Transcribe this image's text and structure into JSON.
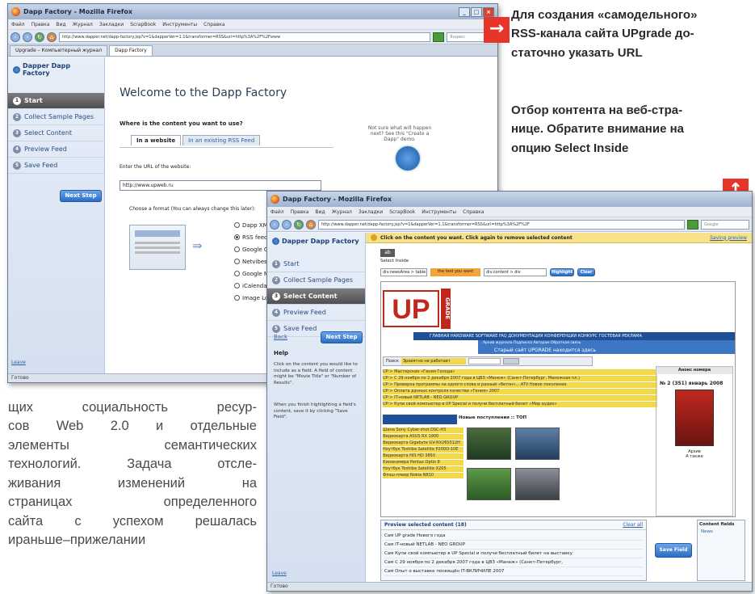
{
  "captions": {
    "top": "Для создания «самодельного»\nRSS-канала сайта UPgrade до-\nстаточно указать URL",
    "middle": "Отбор контента на веб-стра-\nнице. Обратите внимание на\nопцию Select Inside"
  },
  "article_lines": [
    [
      "щих",
      "социальность",
      "ресур-"
    ],
    [
      "сов",
      "Web",
      "2.0",
      "и",
      "отдельные"
    ],
    [
      "элементы",
      "семантических"
    ],
    [
      "технологий.",
      "Задача",
      "отсле-"
    ],
    [
      "живания",
      "изменений",
      "на"
    ],
    [
      "страницах",
      "определенного"
    ],
    [
      "сайта",
      "с",
      "успехом",
      "решалась"
    ],
    [
      "и",
      "раньше",
      "–",
      "при",
      "желании"
    ]
  ],
  "icons": {
    "arrow_right": "→",
    "arrow_up": "↑"
  },
  "win1": {
    "title": "Dapp Factory - Mozilla Firefox",
    "menu": [
      "Файл",
      "Правка",
      "Вид",
      "Журнал",
      "Закладки",
      "ScrapBook",
      "Инструменты",
      "Справка"
    ],
    "url": "http://www.dapper.net/dapp-factory.jsp?v=1&dapperVer=1.1&transformer=RSS&url=http%3A%2F%2Fwww",
    "search_placeholder": "Яндекс",
    "tabs": [
      "Upgrade – Компьютерный журнал",
      "Dapp Factory"
    ],
    "logo": "Dapper Dapp Factory",
    "steps": [
      "Start",
      "Collect Sample Pages",
      "Select Content",
      "Preview Feed",
      "Save Feed"
    ],
    "next_step": "Next Step",
    "heading": "Welcome to the Dapp Factory",
    "question": "Where is the content you want to use?",
    "content_tabs": [
      "In a website",
      "In an existing RSS Feed"
    ],
    "help_note": "Not sure what will happen next? See this \"Create a Dapp\" demo.",
    "enter_url_label": "Enter the URL of the website:",
    "url_value": "http://www.upweb.ru",
    "format_label": "Choose a format (You can always change this later):",
    "formats": [
      "Dapp XML",
      "RSS feed",
      "Google Gadget",
      "Netvibes",
      "Google Maps",
      "iCalendar",
      "Image Loop"
    ],
    "leave": "Leave",
    "status": "Готово"
  },
  "win2": {
    "title": "Dapp Factory - Mozilla Firefox",
    "menu": [
      "Файл",
      "Правка",
      "Вид",
      "Журнал",
      "Закладки",
      "ScrapBook",
      "Инструменты",
      "Справка"
    ],
    "url": "http://www.dapper.net/dapp-factory.jsp?v=1&dapperVer=1.1&transformer=RSS&url=http%3A%2F%2F",
    "search_placeholder": "Google",
    "logo": "Dapper Dapp Factory",
    "steps": [
      "Start",
      "Collect Sample Pages",
      "Select Content",
      "Preview Feed",
      "Save Feed"
    ],
    "back": "Back",
    "next_step": "Next Step",
    "help_title": "Help",
    "help_text1": "Click on the content you would like to include as a field. A field of content might be \"Movie Title\" or \"Number of Results\".",
    "help_text2": "When you finish highlighting a field's content, save it by clicking \"Save Field\".",
    "leave": "Leave",
    "instruction": "Click on the content you want. Click again to remove selected content",
    "saving": "Saving preview",
    "select_inside": "Select Inside",
    "chip": "ab",
    "tool_tags": [
      "div.newsArea > table",
      "the text you want",
      "div.content > div"
    ],
    "tool_btns": [
      "Highlight",
      "Clear"
    ],
    "site_logo": "UP",
    "site_logo_side": "GRADE",
    "site_menu": "ГЛАВНАЯ  HARDWARE  SOFTWARE  FAQ  ДОКУМЕНТАЦИЯ  КОНФЕРЕНЦИИ  КОНКУРС  ГОСТЕВАЯ  РЕКЛАМА",
    "site_submenu": "Архив журнала   Подписка   Авторам   Обратная связь",
    "site_banner": "Старый сайт UPGRADE находится здесь",
    "search_label": "Поиск",
    "search_value": "Зроиятно не работает",
    "news": [
      "UP:> Мастерские «Гения Голода»",
      "UP:> С 29 ноября по 2 декабря 2007 года в ЦВЗ «Манеж» (Санкт-Петербург, Манежная пл.)",
      "UP:> Проверка программы на одного слова и разный «бетон»... ATV Новое поколение",
      "UP:> Оплата данных контроля качества «Гения» 2007",
      "UP:> IT-новый NETLAB - NEO GROUP",
      "UP:> Купи свой компьютер в UP Special и получи бесплатный билет «Мир аудио»"
    ],
    "side_box_title": "Анонс номера",
    "issue_text": "№ 2 (351) январь 2008",
    "archive": "Архив",
    "also": "А также",
    "section_banner": "Новые поступления :: ТОП",
    "products": [
      "Шина Sony Cyber-shot DSC-H3",
      "Видеокарта ASUS RX 1900",
      "Видеокарта Gigabyte GV-RX26S512H",
      "Ноутбук Toshiba Satellite P200D-10E",
      "Видеокарта HIS HD 3850",
      "Кинокамера Pentax Optio 8",
      "Ноутбук Toshiba Satellite X205",
      "Флэш-плеер Nokia N810"
    ],
    "preview_title": "Preview selected content (18)",
    "preview_clear": "Clear all",
    "preview_items": [
      "Сам UP grade Нового года",
      "Сам IT-новый NETLAB - NEO GROUP",
      "Сам Купи свой компьютер в UP Special и получи бесплатный билет на выставку",
      "Сам С 29 ноября по 2 декабря 2007 года в ЦВЗ «Манеж» (Санкт-Петербург,",
      "Сам Опыт о выставке посвящён IT-ВКЛИЧИЛЕ 2007"
    ],
    "save_field": "Save Field",
    "content_fields_title": "Content fields",
    "content_field": "News",
    "status": "Готово"
  }
}
